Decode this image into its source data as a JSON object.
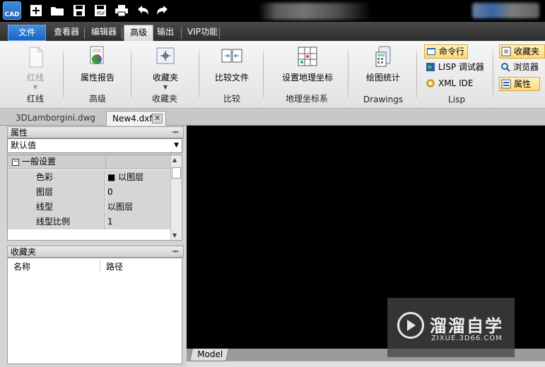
{
  "app": {
    "logo_text": "CAD"
  },
  "quick_access": [
    "new-icon",
    "open-icon",
    "save-icon",
    "save-pdf-icon",
    "print-icon",
    "undo-icon",
    "redo-icon"
  ],
  "tabs": [
    {
      "label": "文件"
    },
    {
      "label": "查看器"
    },
    {
      "label": "编辑器"
    },
    {
      "label": "高级"
    },
    {
      "label": "输出"
    },
    {
      "label": "VIP功能"
    }
  ],
  "ribbon": {
    "groups": [
      {
        "label": "红线",
        "button": "红线"
      },
      {
        "label": "高级",
        "button": "属性报告"
      },
      {
        "label": "收藏夹",
        "button": "收藏夹"
      },
      {
        "label": "比较",
        "button": "比较文件"
      },
      {
        "label": "地理坐标系",
        "button": "设置地理坐标"
      },
      {
        "label": "Drawings",
        "button": "绘图统计"
      },
      {
        "label": "Lisp"
      }
    ],
    "lisp_buttons": [
      "命令行",
      "LISP 调试器",
      "XML IDE"
    ],
    "panel_buttons": [
      "收藏夹",
      "浏览器",
      "属性"
    ]
  },
  "documents": [
    {
      "name": "3DLamborgini.dwg"
    },
    {
      "name": "New4.dxf"
    }
  ],
  "properties": {
    "title": "属性",
    "selector": "默认值",
    "category": "一般设置",
    "rows": [
      {
        "key": "色彩",
        "value": "■ 以图层"
      },
      {
        "key": "图层",
        "value": "0"
      },
      {
        "key": "线型",
        "value": "以图层"
      },
      {
        "key": "线型比例",
        "value": "1"
      }
    ]
  },
  "favorites": {
    "title": "收藏夹",
    "col_name": "名称",
    "col_path": "路径"
  },
  "layout_tab": "Model",
  "watermark": {
    "title": "溜溜自学",
    "sub": "ZIXUE.3D66.COM"
  },
  "colors": {
    "file_tab": "#2a74d2",
    "canvas": "#000000",
    "highlight": "#ffd97a"
  }
}
